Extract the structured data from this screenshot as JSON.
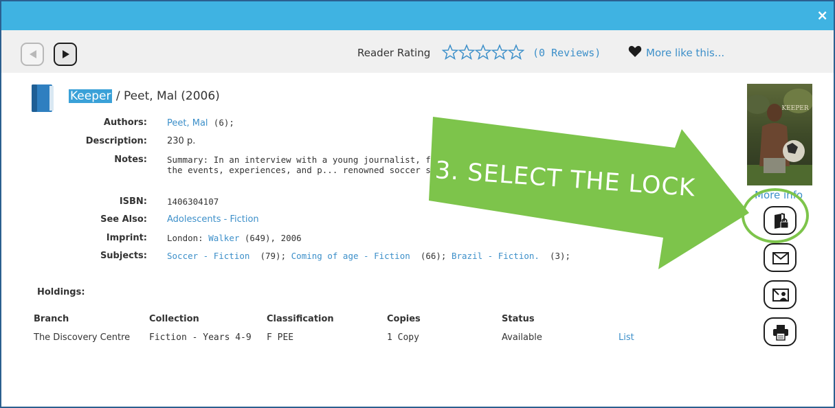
{
  "window": {
    "close_glyph": "×"
  },
  "toolbar": {
    "prev_icon": "triangle-left-icon",
    "next_icon": "triangle-right-icon",
    "rating_label": "Reader Rating",
    "stars_filled": 0,
    "stars_total": 5,
    "reviews": "(0 Reviews)",
    "more_like": "More like this..."
  },
  "record": {
    "title": "Keeper",
    "separator": " / ",
    "author_year": "Peet, Mal  (2006)",
    "fields": {
      "authors": {
        "label": "Authors:",
        "link": "Peet, Mal",
        "count": "(6);"
      },
      "description": {
        "label": "Description:",
        "value": "230 p."
      },
      "notes": {
        "label": "Notes:",
        "value": "Summary: In an interview with a young journalist, fiction... his youth in the Brazilian rain forest and the events, experiences, and p... renowned soccer star."
      },
      "isbn": {
        "label": "ISBN:",
        "value": "1406304107"
      },
      "see_also": {
        "label": "See Also:",
        "link": "Adolescents - Fiction"
      },
      "imprint": {
        "label": "Imprint:",
        "prefix": "London:",
        "link": "Walker",
        "suffix": "(649), 2006"
      },
      "subjects": {
        "label": "Subjects:",
        "s1": "Soccer - Fiction",
        "c1": "(79);",
        "s2": "Coming of age - Fiction",
        "c2": "(66);",
        "s3": "Brazil - Fiction.",
        "c3": "(3);"
      }
    }
  },
  "holdings": {
    "title": "Holdings:",
    "headers": {
      "branch": "Branch",
      "collection": "Collection",
      "classification": "Classification",
      "copies": "Copies",
      "status": "Status"
    },
    "row": {
      "branch": "The Discovery Centre",
      "collection": "Fiction - Years 4-9",
      "classification": "F PEE",
      "copies": "1 Copy",
      "status": "Available",
      "list": "List"
    }
  },
  "side": {
    "cover_text": "KEEPER",
    "more_info": "More info",
    "buttons": [
      "lock-book-icon",
      "email-icon",
      "email-screen-icon",
      "print-icon"
    ]
  },
  "callout": {
    "text": "3. SELECT THE LOCK",
    "color": "#7dc44b"
  }
}
